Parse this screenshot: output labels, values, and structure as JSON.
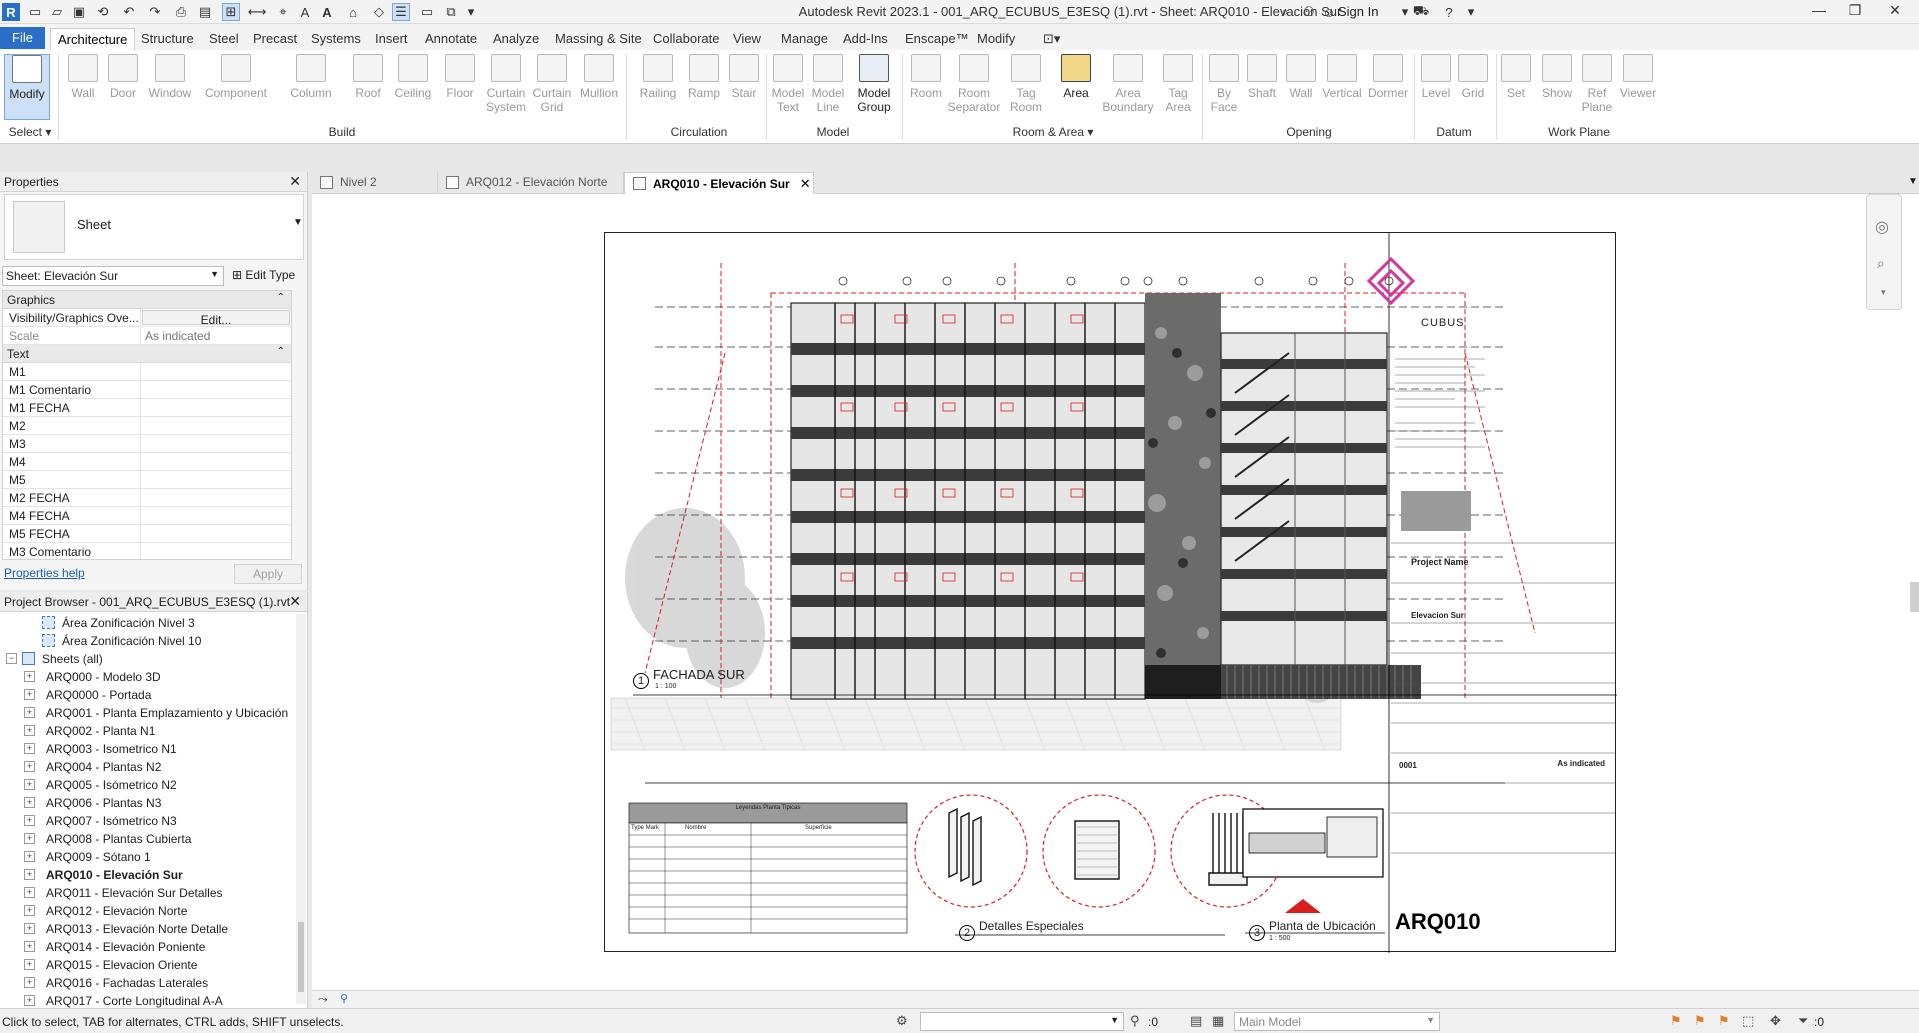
{
  "title_bar": {
    "title": "Autodesk Revit 2023.1 - 001_ARQ_ECUBUS_E3ESQ (1).rvt - Sheet: ARQ010 - Elevación Sur",
    "sign_in": "Sign In",
    "app_logo": "R"
  },
  "ribbon_tabs": [
    "File",
    "Architecture",
    "Structure",
    "Steel",
    "Precast",
    "Systems",
    "Insert",
    "Annotate",
    "Analyze",
    "Massing & Site",
    "Collaborate",
    "View",
    "Manage",
    "Add-Ins",
    "Enscape™",
    "Modify"
  ],
  "ribbon": {
    "select_label": "Select",
    "modify": "Modify",
    "build": [
      "Wall",
      "Door",
      "Window",
      "Component",
      "Column",
      "Roof",
      "Ceiling",
      "Floor",
      "Curtain System",
      "Curtain Grid",
      "Mullion"
    ],
    "circulation": [
      "Railing",
      "Ramp",
      "Stair"
    ],
    "model": [
      "Model Text",
      "Model Line",
      "Model Group"
    ],
    "room_area": [
      "Room",
      "Room Separator",
      "Tag Room",
      "Area",
      "Area Boundary",
      "Tag Area"
    ],
    "opening": [
      "By Face",
      "Shaft",
      "Wall",
      "Vertical",
      "Dormer"
    ],
    "datum": [
      "Level",
      "Grid"
    ],
    "work_plane": [
      "Set",
      "Show",
      "Ref Plane",
      "Viewer"
    ],
    "panels": [
      "Build",
      "Circulation",
      "Model",
      "Room & Area",
      "Opening",
      "Datum",
      "Work Plane"
    ]
  },
  "properties": {
    "header": "Properties",
    "type_name": "Sheet",
    "instance_selector": "Sheet: Elevación Sur",
    "edit_type": "Edit Type",
    "groups": [
      {
        "name": "Graphics",
        "rows": [
          {
            "key": "Visibility/Graphics Ove...",
            "value": "Edit..."
          },
          {
            "key": "Scale",
            "value": "As indicated"
          }
        ]
      },
      {
        "name": "Text",
        "rows": [
          {
            "key": "M1",
            "value": ""
          },
          {
            "key": "M1 Comentario",
            "value": ""
          },
          {
            "key": "M1 FECHA",
            "value": ""
          },
          {
            "key": "M2",
            "value": ""
          },
          {
            "key": "M3",
            "value": ""
          },
          {
            "key": "M4",
            "value": ""
          },
          {
            "key": "M5",
            "value": ""
          },
          {
            "key": "M2 FECHA",
            "value": ""
          },
          {
            "key": "M4 FECHA",
            "value": ""
          },
          {
            "key": "M5 FECHA",
            "value": ""
          },
          {
            "key": "M3 Comentario",
            "value": ""
          }
        ]
      }
    ],
    "help": "Properties help",
    "apply": "Apply"
  },
  "project_browser": {
    "header": "Project Browser - 001_ARQ_ECUBUS_E3ESQ (1).rvt",
    "area_items": [
      "Área Zonificación Nivel 3",
      "Área Zonificación Nivel 10"
    ],
    "sheets_header": "Sheets (all)",
    "sheets": [
      "ARQ000 - Modelo 3D",
      "ARQ0000 - Portada",
      "ARQ001 - Planta Emplazamiento y Ubicación",
      "ARQ002 - Planta N1",
      "ARQ003 - Isometrico N1",
      "ARQ004 - Plantas N2",
      "ARQ005 - Isómetrico N2",
      "ARQ006 - Plantas N3",
      "ARQ007 - Isómetrico N3",
      "ARQ008 - Plantas Cubierta",
      "ARQ009 - Sótano 1",
      "ARQ010 - Elevación Sur",
      "ARQ011 - Elevación Sur Detalles",
      "ARQ012 - Elevación Norte",
      "ARQ013 - Elevación Norte Detalle",
      "ARQ014 - Elevación Poniente",
      "ARQ015 - Elevacion Oriente",
      "ARQ016 - Fachadas Laterales",
      "ARQ017 - Corte Longitudinal A-A"
    ],
    "active_sheet": "ARQ010 - Elevación Sur"
  },
  "view_tabs": [
    {
      "label": "Nivel 2",
      "active": false
    },
    {
      "label": "ARQ012 - Elevación Norte",
      "active": false
    },
    {
      "label": "ARQ010 - Elevación Sur",
      "active": true
    }
  ],
  "sheet": {
    "logo_text": "CUBUS",
    "view1_number": "1",
    "view1_title": "FACHADA SUR",
    "view1_scale": "1 : 100",
    "view2_number": "2",
    "view2_title": "Detalles Especiales",
    "view3_number": "3",
    "view3_title": "Planta de Ubicación",
    "view3_scale": "1 : 500",
    "project_name": "Project Name",
    "sheet_name": "Elevacion Sur",
    "sheet_number": "ARQ010",
    "as_indicated": "As indicated",
    "number_small": "0001",
    "legend_title": "Leyendas Planta Tipicas",
    "legend_headers": [
      "Type Mark",
      "Nombre",
      "Superficie"
    ]
  },
  "status_bar": {
    "text": "Click to select, TAB for alternates, CTRL adds, SHIFT unselects.",
    "selection_count": ":0",
    "model": "Main Model",
    "filter_count": ":0"
  }
}
